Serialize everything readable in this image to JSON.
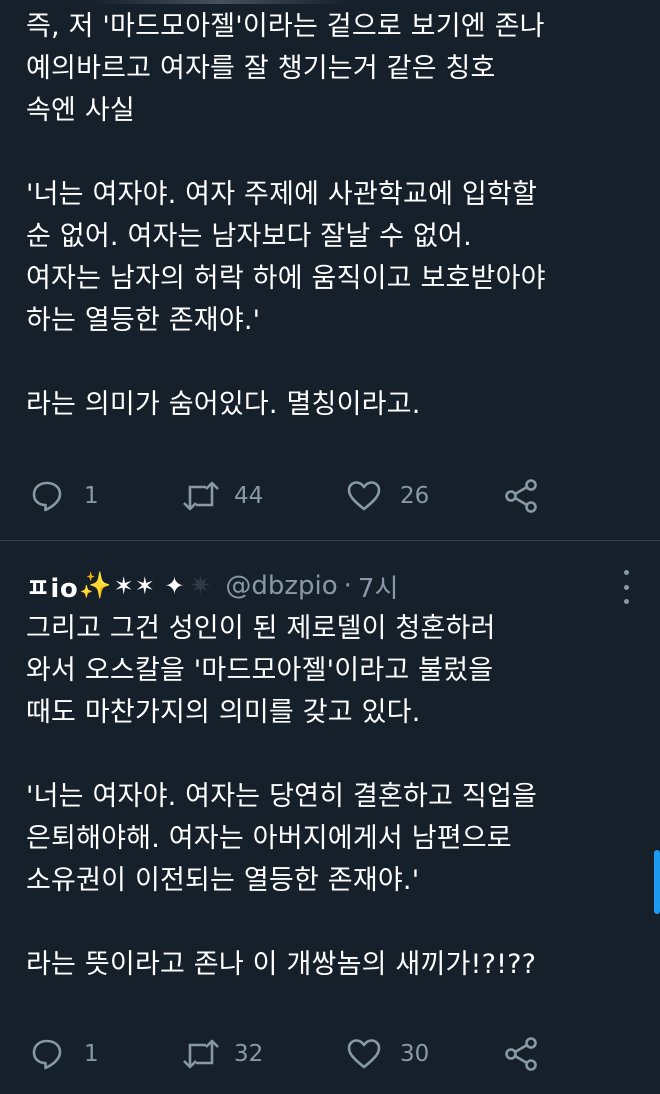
{
  "tweet1": {
    "text": "즉, 저 '마드모아젤'이라는 겉으로 보기엔 존나\n예의바르고 여자를 잘 챙기는거 같은 칭호\n속엔 사실\n\n'너는 여자야. 여자 주제에 사관학교에 입학할\n순 없어. 여자는 남자보다 잘날 수 없어.\n여자는 남자의 허락 하에 움직이고 보호받아야\n하는 열등한 존재야.'\n\n라는 의미가 숨어있다. 멸칭이라고.",
    "reply_count": "1",
    "retweet_count": "44",
    "like_count": "26"
  },
  "tweet2": {
    "display_name": "ㅍio",
    "sparkle_emoji": "✨",
    "stars": "✶✶ ✦",
    "dim_star": "✷",
    "handle": "@dbzpio",
    "separator": "·",
    "time": "7시",
    "text": "그리고 그건 성인이 된 제로델이 청혼하러\n와서 오스칼을 '마드모아젤'이라고 불렀을\n때도 마찬가지의 의미를 갖고 있다.\n\n'너는 여자야. 여자는 당연히 결혼하고 직업을\n은퇴해야해. 여자는 아버지에게서 남편으로\n소유권이 이전되는 열등한 존재야.'\n\n라는 뜻이라고 존나 이 개쌍놈의 새끼가!?!??",
    "reply_count": "1",
    "retweet_count": "32",
    "like_count": "30"
  },
  "icons": {
    "reply": "reply-icon",
    "retweet": "retweet-icon",
    "like": "heart-icon",
    "share": "share-icon",
    "more": "more-vertical-icon"
  },
  "colors": {
    "background": "#15202b",
    "text": "#ffffff",
    "muted": "#8899a6",
    "divider": "#38444d",
    "accent": "#1d9bf0"
  }
}
